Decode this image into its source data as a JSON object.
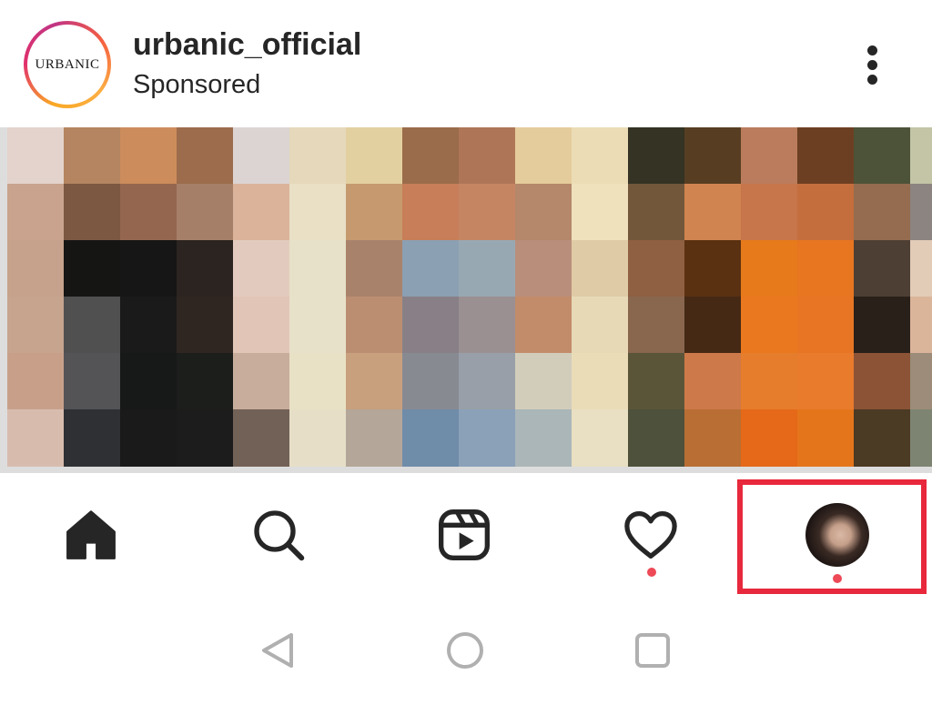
{
  "post": {
    "username": "urbanic_official",
    "subtitle": "Sponsored",
    "brand_logo_text": "URBANIC"
  },
  "post_image": {
    "description_icon": "pixelated-product-image",
    "pixel_colors": [
      [
        "#e3d3cc",
        "#b48560",
        "#cd8c5c",
        "#9c6c4c",
        "#dcd4d3",
        "#e5d8bb",
        "#e3d0a0",
        "#9a6c4b",
        "#ae7657",
        "#e5cc9c",
        "#ebdcb5",
        "#343324",
        "#573e22",
        "#ba7c5c",
        "#6c3f22",
        "#4d5338",
        "#c3c5a6"
      ],
      [
        "#c9a38d",
        "#7c5842",
        "#946650",
        "#a67f68",
        "#dbb39a",
        "#e9e0c6",
        "#c69a6e",
        "#c77e59",
        "#c58563",
        "#b5876b",
        "#eee1bb",
        "#72573b",
        "#d08450",
        "#c7754a",
        "#c46e3d",
        "#956c4f",
        "#8c8480"
      ],
      [
        "#c6a28c",
        "#151514",
        "#161616",
        "#2b2420",
        "#e2cbbe",
        "#e6e1c8",
        "#a9826c",
        "#8ba0b3",
        "#98a8b3",
        "#b98f7c",
        "#dfcba6",
        "#8f6041",
        "#5a3111",
        "#e77a1a",
        "#e87520",
        "#4e3f34",
        "#e2ccb8"
      ],
      [
        "#c6a48e",
        "#505051",
        "#1a1a1a",
        "#302621",
        "#e1c6b8",
        "#e8e1ca",
        "#bb8e72",
        "#888086",
        "#9a9092",
        "#c28c6a",
        "#e7d9b5",
        "#89664e",
        "#452915",
        "#e9781e",
        "#e77523",
        "#29201a",
        "#dbb59a"
      ],
      [
        "#c8a089",
        "#545456",
        "#171818",
        "#1b1e1a",
        "#c8ad9d",
        "#e9e1c6",
        "#c8a07d",
        "#888a92",
        "#989fa8",
        "#d2cdbb",
        "#e9dcb7",
        "#5a5538",
        "#ce7949",
        "#e67d2c",
        "#e97b2d",
        "#8c5336",
        "#9c8c79"
      ],
      [
        "#d7bcae",
        "#2f3034",
        "#1a1a1a",
        "#1c1c1c",
        "#726156",
        "#e7dec8",
        "#b4a698",
        "#6f8ca9",
        "#8aa1b8",
        "#aab6b8",
        "#e9dfc2",
        "#4e513b",
        "#b96e34",
        "#e56919",
        "#e4751b",
        "#4b3a24",
        "#7e8472"
      ]
    ]
  },
  "bottom_nav": {
    "items": [
      {
        "name": "home",
        "icon": "home-icon",
        "active": true
      },
      {
        "name": "search",
        "icon": "search-icon"
      },
      {
        "name": "reels",
        "icon": "reels-icon"
      },
      {
        "name": "activity",
        "icon": "heart-icon",
        "notification": true
      },
      {
        "name": "profile",
        "icon": "profile-avatar",
        "notification": true,
        "highlighted": true
      }
    ],
    "highlight_color": "#e8283c",
    "notification_color": "#ed4956"
  },
  "system_nav": {
    "buttons": [
      "back-icon",
      "home-circle-icon",
      "recents-icon"
    ]
  }
}
